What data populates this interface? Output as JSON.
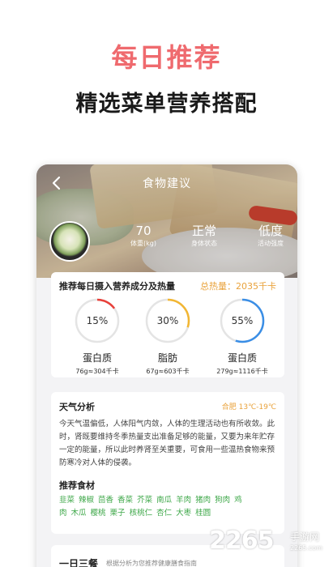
{
  "promo": {
    "title": "每日推荐",
    "subtitle": "精选菜单营养搭配"
  },
  "header": {
    "title": "食物建议",
    "back_icon": "chevron-left-icon"
  },
  "stats": [
    {
      "value": "70",
      "label": "体重(kg)"
    },
    {
      "value": "正常",
      "label": "身体状态"
    },
    {
      "value": "低度",
      "label": "活动强度"
    }
  ],
  "nutrition": {
    "title": "推荐每日摄入营养成分及热量",
    "total": "总热量：2035千卡",
    "items": [
      {
        "percent": "15%",
        "fraction": 0.15,
        "color": "#e8403a",
        "name": "蛋白质",
        "amount": "76g≈304千卡"
      },
      {
        "percent": "30%",
        "fraction": 0.3,
        "color": "#f2b632",
        "name": "脂肪",
        "amount": "67g≈603千卡"
      },
      {
        "percent": "55%",
        "fraction": 0.55,
        "color": "#3a8ee6",
        "name": "蛋白质",
        "amount": "279g≈1116千卡"
      }
    ]
  },
  "weather": {
    "title": "天气分析",
    "info": "合肥  13℃-19℃",
    "description": "今天气温偏低，人体阳气内敛，人体的生理活动也有所收敛。此时，肾既要维持冬季热量支出准备足够的能量，又要为来年贮存一定的能量，所以此时养肾至关重要，可食用一些温热食物来预防寒冷对人体的侵袭。",
    "food_title": "推荐食材",
    "foods": [
      "韭菜",
      "辣椒",
      "茴香",
      "香菜",
      "芥菜",
      "南瓜",
      "羊肉",
      "猪肉",
      "狗肉",
      "鸡肉",
      "木瓜",
      "樱桃",
      "栗子",
      "核桃仁",
      "杏仁",
      "大枣",
      "桂圆"
    ]
  },
  "meals": {
    "title": "一日三餐",
    "subtitle": "根据分析为您推荐健康膳食指南"
  },
  "watermark": {
    "number": "2265",
    "text": "手游网",
    "domain": "2265.com"
  }
}
